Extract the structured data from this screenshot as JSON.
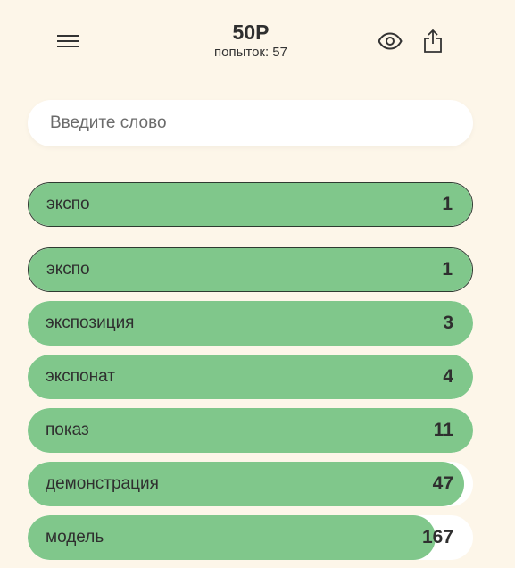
{
  "header": {
    "title": "50P",
    "attempts": "попыток: 57",
    "menu_icon": "menu-icon",
    "eye_icon": "eye-icon",
    "share_icon": "share-icon"
  },
  "search": {
    "placeholder": "Введите слово",
    "value": ""
  },
  "colors": {
    "background": "#fdf6e9",
    "bar_fill": "#80c78b",
    "bar_track": "#ffffff"
  },
  "last_guess": {
    "word": "экспо",
    "rank": "1",
    "closeness": 1.0
  },
  "guesses": [
    {
      "word": "экспо",
      "rank": "1",
      "closeness": 1.0,
      "current": true
    },
    {
      "word": "экспозиция",
      "rank": "3",
      "closeness": 1.0,
      "current": false
    },
    {
      "word": "экспонат",
      "rank": "4",
      "closeness": 1.0,
      "current": false
    },
    {
      "word": "показ",
      "rank": "11",
      "closeness": 1.0,
      "current": false
    },
    {
      "word": "демонстрация",
      "rank": "47",
      "closeness": 0.98,
      "current": false
    },
    {
      "word": "модель",
      "rank": "167",
      "closeness": 0.915,
      "current": false
    }
  ]
}
